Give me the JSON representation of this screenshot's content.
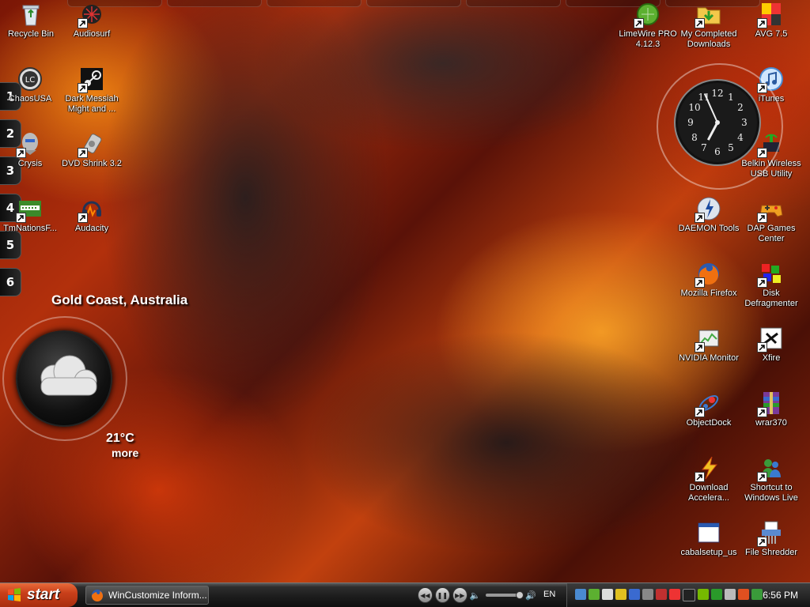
{
  "desktop": {
    "left_icons": [
      {
        "name": "recycle-bin-icon",
        "label": "Recycle Bin"
      },
      {
        "name": "audiosurf-icon",
        "label": "Audiosurf"
      },
      {
        "name": "chaosusa-icon",
        "label": "ChaosUSA"
      },
      {
        "name": "dark-messiah-icon",
        "label": "Dark Messiah Might and ..."
      },
      {
        "name": "crysis-icon",
        "label": "Crysis"
      },
      {
        "name": "dvd-shrink-icon",
        "label": "DVD Shrink 3.2"
      },
      {
        "name": "tmnations-icon",
        "label": "TmNationsF..."
      },
      {
        "name": "audacity-icon",
        "label": "Audacity"
      }
    ],
    "right_icons": [
      {
        "name": "limewire-icon",
        "label": "LimeWire PRO 4.12.3"
      },
      {
        "name": "my-completed-downloads-icon",
        "label": "My Completed Downloads"
      },
      {
        "name": "avg-icon",
        "label": "AVG 7.5"
      },
      {
        "name": "itunes-icon",
        "label": "iTunes"
      },
      {
        "name": "belkin-wireless-icon",
        "label": "Belkin Wireless USB Utility"
      },
      {
        "name": "daemon-tools-icon",
        "label": "DAEMON Tools"
      },
      {
        "name": "dap-games-icon",
        "label": "DAP Games Center"
      },
      {
        "name": "firefox-icon",
        "label": "Mozilla Firefox"
      },
      {
        "name": "disk-defragmenter-icon",
        "label": "Disk Defragmenter"
      },
      {
        "name": "nvidia-monitor-icon",
        "label": "NVIDIA Monitor"
      },
      {
        "name": "xfire-icon",
        "label": "Xfire"
      },
      {
        "name": "objectdock-icon",
        "label": "ObjectDock"
      },
      {
        "name": "wrar-icon",
        "label": "wrar370"
      },
      {
        "name": "download-accelerator-icon",
        "label": "Download Accelera..."
      },
      {
        "name": "windows-live-icon",
        "label": "Shortcut to Windows Live"
      },
      {
        "name": "cabalsetup-icon",
        "label": "cabalsetup_us"
      },
      {
        "name": "file-shredder-icon",
        "label": "File Shredder"
      }
    ]
  },
  "virtual_desktops": [
    "1",
    "2",
    "3",
    "4",
    "5",
    "6"
  ],
  "weather": {
    "city": "Gold Coast, Australia",
    "temperature": "21°C",
    "more": "more",
    "condition_icon": "cloud-icon"
  },
  "clock": {
    "hour": 6,
    "minute": 56
  },
  "taskbar": {
    "start_label": "start",
    "task_button": "WinCustomize Inform...",
    "language": "EN",
    "time": "6:56 PM",
    "media_controls": [
      "previous",
      "pause",
      "next"
    ]
  },
  "colors": {
    "start_button": "#c9401a",
    "taskbar": "#1b1b1b"
  }
}
